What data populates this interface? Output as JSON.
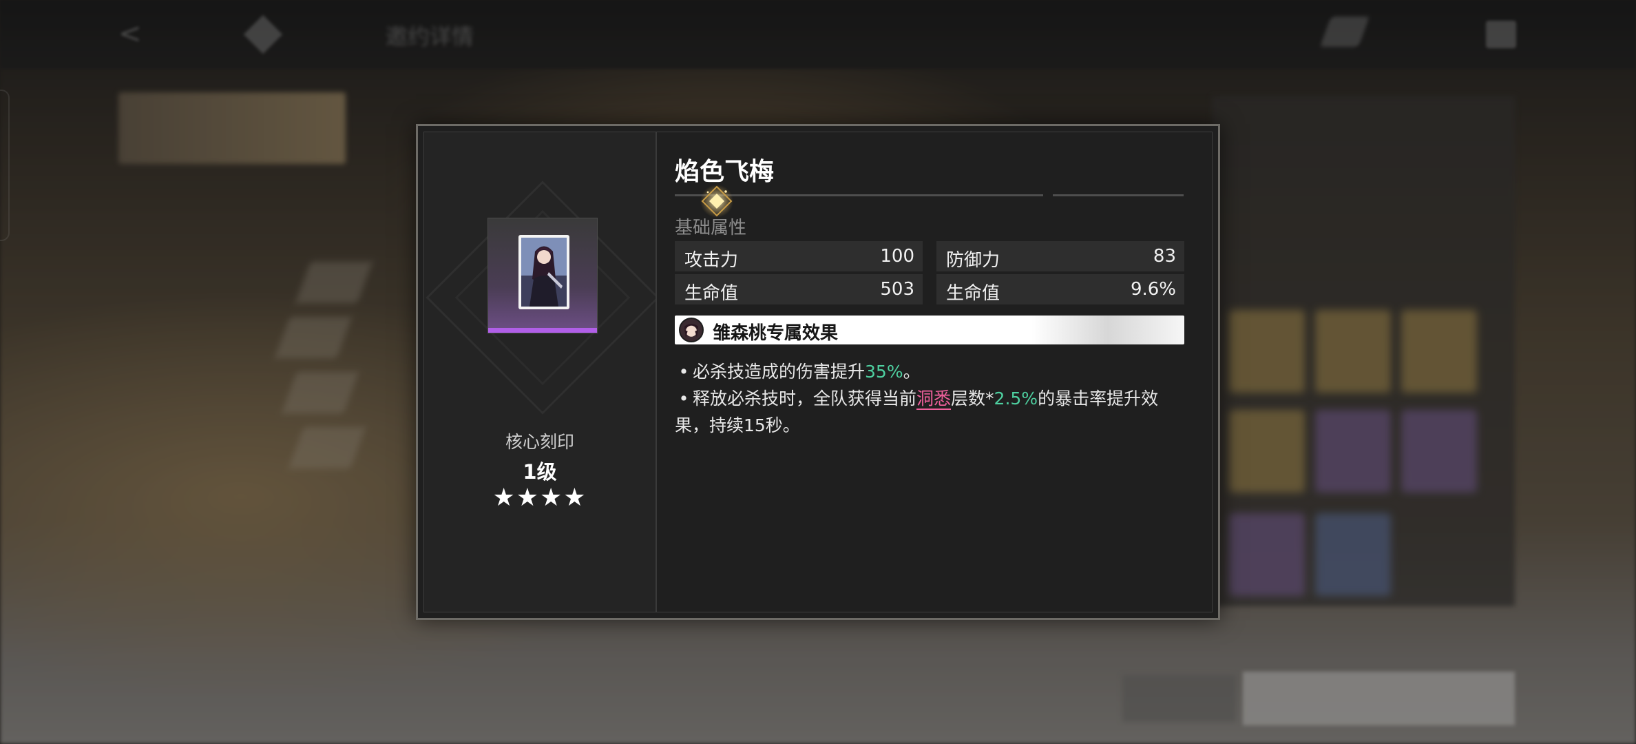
{
  "background": {
    "topbar_title": "邀约详情"
  },
  "modal": {
    "item_title": "焰色飞梅",
    "core": {
      "label": "核心刻印",
      "level": "1级",
      "stars": "★★★★",
      "star_count": 4
    },
    "base_stats_label": "基础属性",
    "stats": [
      {
        "name": "攻击力",
        "value": "100"
      },
      {
        "name": "防御力",
        "value": "83"
      },
      {
        "name": "生命值",
        "value": "503"
      },
      {
        "name": "生命值",
        "value": "9.6%"
      }
    ],
    "effect": {
      "header": "雏森桃专属效果",
      "line1_prefix": "必杀技造成的伤害提升",
      "line1_value": "35%",
      "line1_suffix": "。",
      "line2_a": "释放必杀技时，全队获得当前",
      "line2_keyword": "洞悉",
      "line2_b": "层数*",
      "line2_value": "2.5%",
      "line2_c": "的暴击率提升效果，持续15秒。"
    }
  },
  "colors": {
    "accent_green": "#4ed0a0",
    "keyword_pink": "#f0609c",
    "rarity_purple": "#b15fe8"
  }
}
